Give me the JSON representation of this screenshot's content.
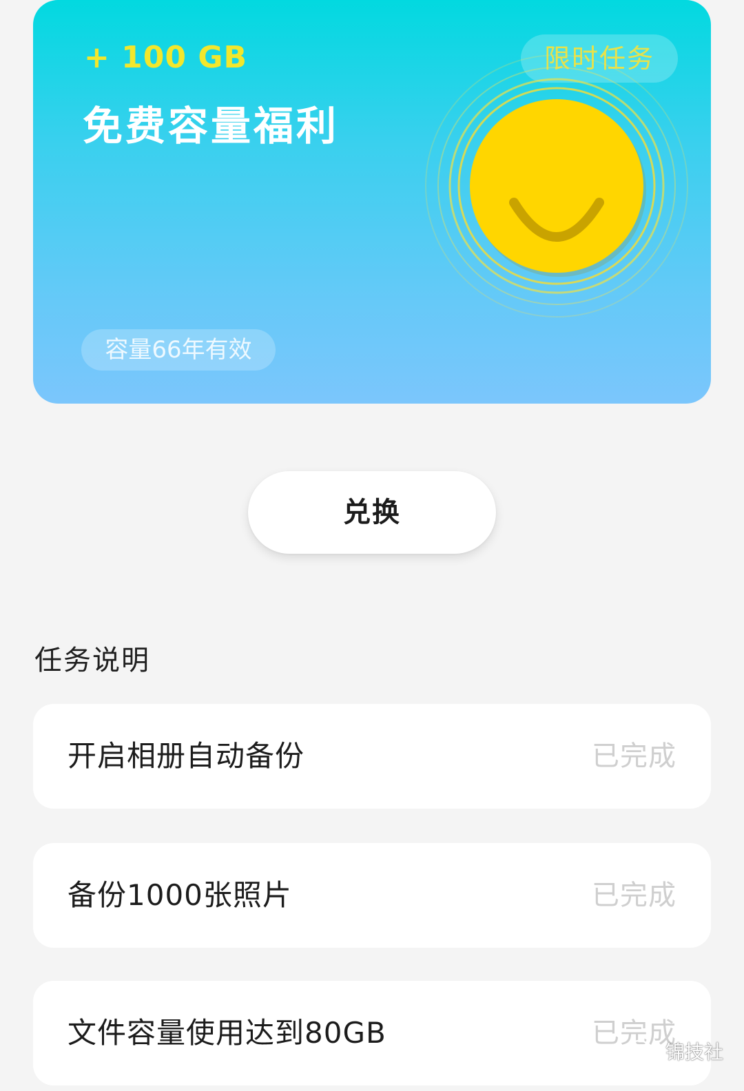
{
  "promo": {
    "amount": "+ 100 GB",
    "title": "免费容量福利",
    "badge": "限时任务",
    "validity": "容量66年有效"
  },
  "redeem_button": "兑换",
  "tasks_section": {
    "title": "任务说明",
    "items": [
      {
        "label": "开启相册自动备份",
        "status": "已完成"
      },
      {
        "label": "备份1000张照片",
        "status": "已完成"
      },
      {
        "label": "文件容量使用达到80GB",
        "status": "已完成"
      }
    ]
  },
  "watermark": {
    "text": "锦技社",
    "icon": "wechat-icon"
  },
  "colors": {
    "card_gradient_top": "#02d9e0",
    "card_gradient_bottom": "#7bc6fc",
    "amount_yellow": "#f2e72c",
    "smiley_yellow": "#ffd600",
    "status_gray": "#cfcfcf",
    "background": "#f4f4f4"
  }
}
